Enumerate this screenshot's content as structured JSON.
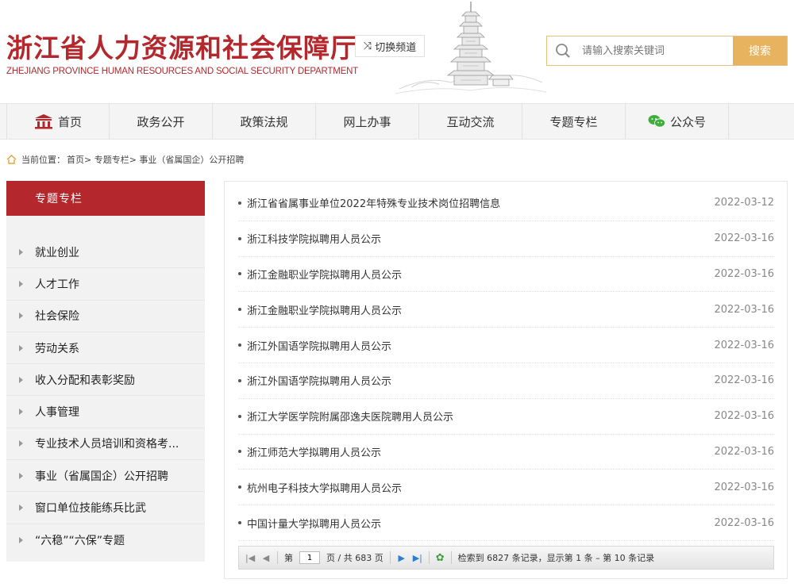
{
  "header": {
    "title_cn": "浙江省人力资源和社会保障厅",
    "title_en": "ZHEJIANG PROVINCE HUMAN RESOURCES AND SOCIAL SECURITY DEPARTMENT",
    "switch_channel": "切换频道"
  },
  "search": {
    "placeholder": "请输入搜索关键词",
    "button": "搜索"
  },
  "nav": {
    "items": [
      "首页",
      "政务公开",
      "政策法规",
      "网上办事",
      "互动交流",
      "专题专栏",
      "公众号"
    ]
  },
  "breadcrumb": {
    "label": "当前位置：",
    "path": "首页> 专题专栏> 事业（省属国企）公开招聘"
  },
  "sidebar": {
    "title": "专题专栏",
    "items": [
      "就业创业",
      "人才工作",
      "社会保险",
      "劳动关系",
      "收入分配和表彰奖励",
      "人事管理",
      "专业技术人员培训和资格考...",
      "事业（省属国企）公开招聘",
      "窗口单位技能练兵比武",
      "“六稳”“六保”专题"
    ]
  },
  "list": {
    "rows": [
      {
        "title": "浙江省省属事业单位2022年特殊专业技术岗位招聘信息",
        "date": "2022-03-12"
      },
      {
        "title": "浙江科技学院拟聘用人员公示",
        "date": "2022-03-16"
      },
      {
        "title": "浙江金融职业学院拟聘用人员公示",
        "date": "2022-03-16"
      },
      {
        "title": "浙江金融职业学院拟聘用人员公示",
        "date": "2022-03-16"
      },
      {
        "title": "浙江外国语学院拟聘用人员公示",
        "date": "2022-03-16"
      },
      {
        "title": "浙江外国语学院拟聘用人员公示",
        "date": "2022-03-16"
      },
      {
        "title": "浙江大学医学院附属邵逸夫医院聘用人员公示",
        "date": "2022-03-16"
      },
      {
        "title": "浙江师范大学拟聘用人员公示",
        "date": "2022-03-16"
      },
      {
        "title": "杭州电子科技大学拟聘用人员公示",
        "date": "2022-03-16"
      },
      {
        "title": "中国计量大学拟聘用人员公示",
        "date": "2022-03-16"
      }
    ]
  },
  "pager": {
    "page_prefix": "第",
    "current_page": "1",
    "page_suffix": "页 / 共 683 页",
    "summary": "检索到 6827 条记录，显示第 1 条 – 第 10 条记录"
  }
}
